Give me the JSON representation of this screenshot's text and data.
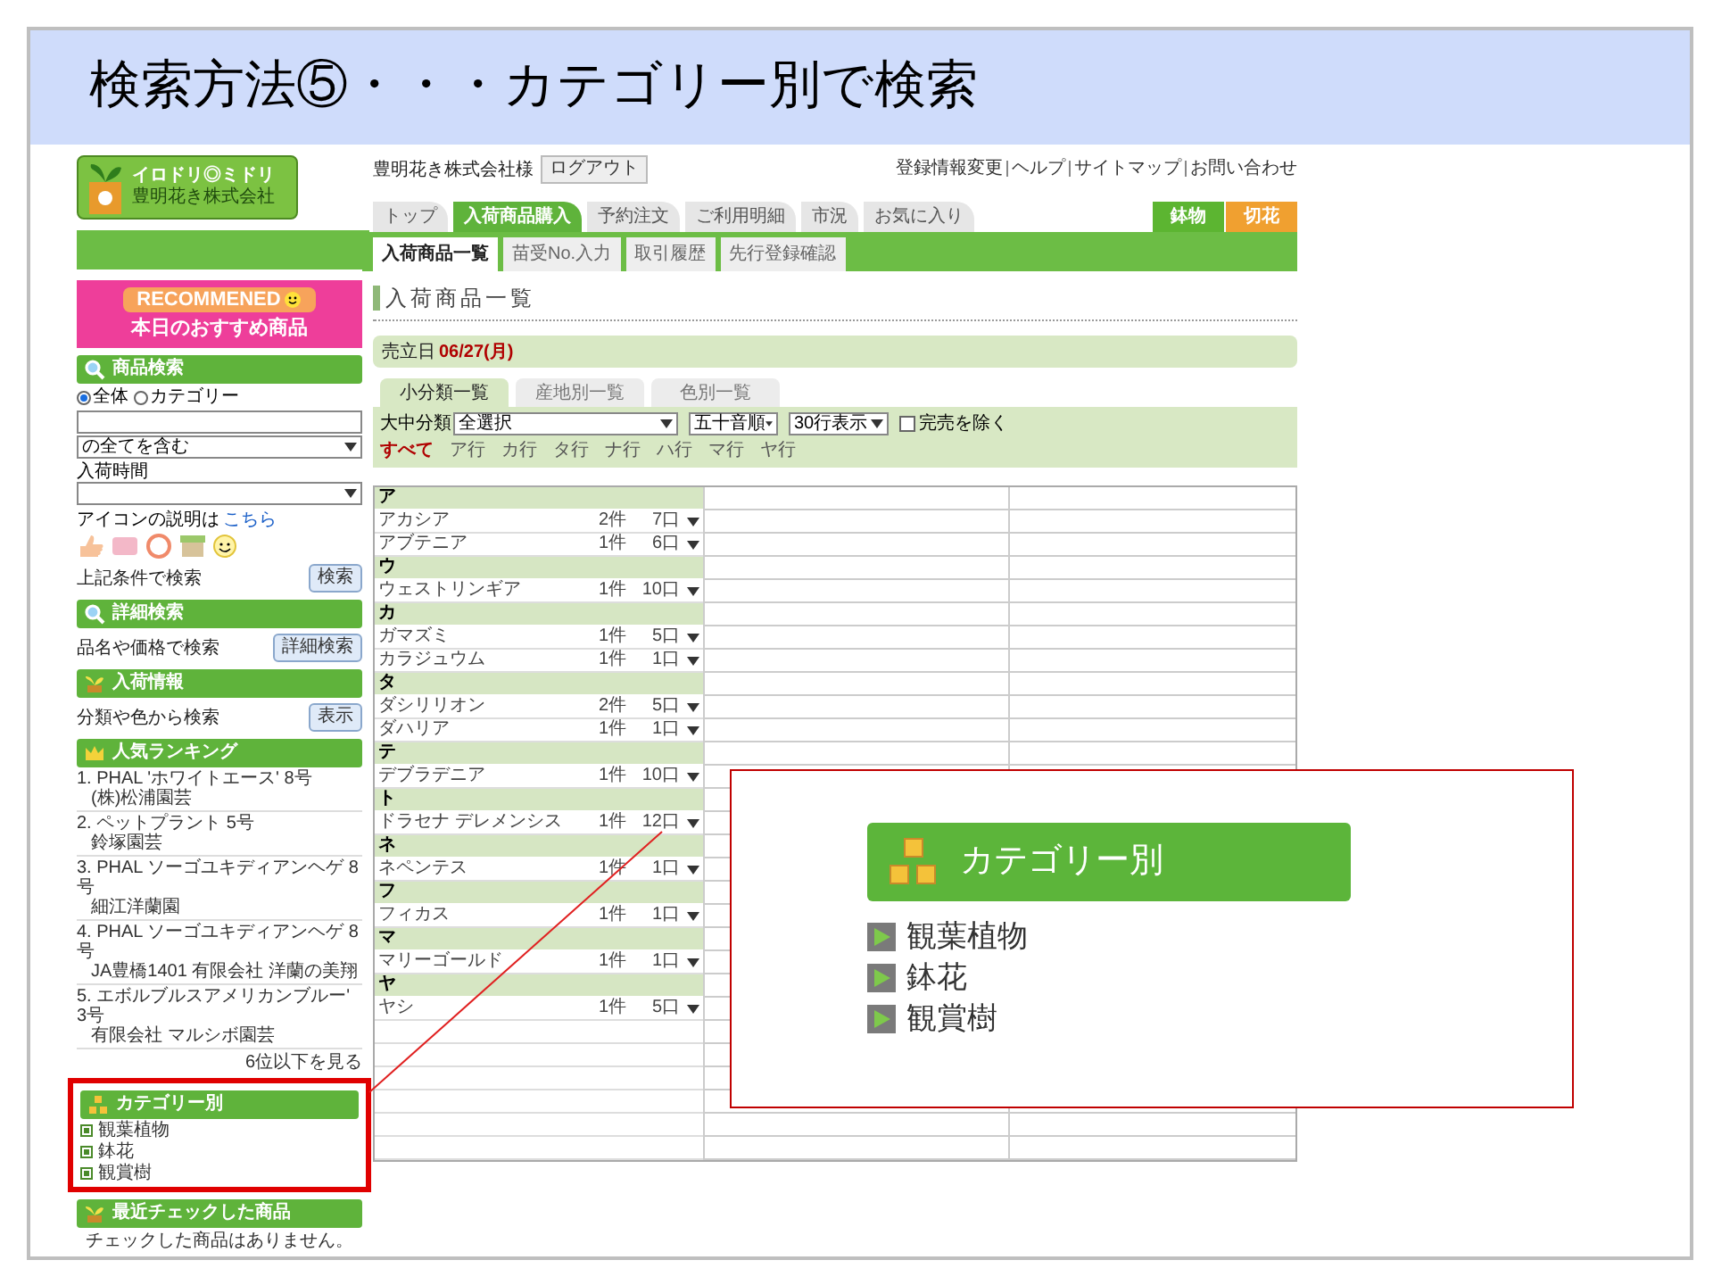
{
  "slide": {
    "title": "検索方法⑤・・・カテゴリー別で検索"
  },
  "logo": {
    "name": "イロドリ◎ミドリ",
    "company": "豊明花き株式会社"
  },
  "header": {
    "customer": "豊明花き株式会社様",
    "logout": "ログアウト",
    "links": [
      "登録情報変更",
      "ヘルプ",
      "サイトマップ",
      "お問い合わせ"
    ]
  },
  "main_tabs": [
    {
      "label": "トップ",
      "selected": false
    },
    {
      "label": "入荷商品購入",
      "selected": true
    },
    {
      "label": "予約注文",
      "selected": false
    },
    {
      "label": "ご利用明細",
      "selected": false
    },
    {
      "label": "市況",
      "selected": false
    },
    {
      "label": "お気に入り",
      "selected": false
    }
  ],
  "market_tabs": [
    {
      "label": "鉢物",
      "color": "#5cb531"
    },
    {
      "label": "切花",
      "color": "#f0a030"
    }
  ],
  "sub_tabs": [
    {
      "label": "入荷商品一覧",
      "selected": true
    },
    {
      "label": "苗受No.入力",
      "selected": false
    },
    {
      "label": "取引履歴",
      "selected": false
    },
    {
      "label": "先行登録確認",
      "selected": false
    }
  ],
  "sidebar": {
    "banner": {
      "title": "RECOMMENED",
      "subtitle": "本日のおすすめ商品"
    },
    "search": {
      "heading": "商品検索",
      "scope": [
        {
          "label": "全体",
          "selected": true
        },
        {
          "label": "カテゴリー",
          "selected": false
        }
      ],
      "match_select": "の全てを含む",
      "time_label": "入荷時間",
      "icon_note": "アイコンの説明は",
      "icon_link": "こちら",
      "hint": "上記条件で検索",
      "button": "検索"
    },
    "detail": {
      "heading": "詳細検索",
      "hint": "品名や価格で検索",
      "button": "詳細検索"
    },
    "arrivals": {
      "heading": "入荷情報",
      "hint": "分類や色から検索",
      "button": "表示"
    },
    "ranking": {
      "heading": "人気ランキング",
      "items": [
        {
          "title": "1. PHAL 'ホワイトエース' 8号",
          "shop": "(株)松浦園芸"
        },
        {
          "title": "2. ペットプラント 5号",
          "shop": "鈴塚園芸"
        },
        {
          "title": "3. PHAL ソーゴユキディアンヘゲ 8号",
          "shop": "細江洋蘭園"
        },
        {
          "title": "4. PHAL ソーゴユキディアンヘゲ 8号",
          "shop": "JA豊橋1401 有限会社 洋蘭の美翔"
        },
        {
          "title": "5. エボルブルスアメリカンブルー' 3号",
          "shop": "有限会社 マルシボ園芸"
        }
      ],
      "more": "6位以下を見る"
    },
    "category": {
      "heading": "カテゴリー別",
      "items": [
        "観葉植物",
        "鉢花",
        "観賞樹"
      ]
    },
    "recent": {
      "heading": "最近チェックした商品",
      "message": "チェックした商品はありません。"
    }
  },
  "page": {
    "heading": "入荷商品一覧",
    "date_label": "売立日",
    "date": "06/27(月)",
    "list_tabs": [
      {
        "label": "小分類一覧",
        "selected": true
      },
      {
        "label": "産地別一覧",
        "selected": false
      },
      {
        "label": "色別一覧",
        "selected": false
      }
    ],
    "filters": {
      "class_label": "大中分類",
      "class_value": "全選択",
      "sort": "五十音順",
      "rows": "30行表示",
      "exclude_soldout": {
        "label": "完売を除く",
        "checked": false
      }
    },
    "kana": [
      {
        "label": "すべて",
        "selected": true
      },
      {
        "label": "ア行",
        "selected": false
      },
      {
        "label": "カ行",
        "selected": false
      },
      {
        "label": "タ行",
        "selected": false
      },
      {
        "label": "ナ行",
        "selected": false
      },
      {
        "label": "ハ行",
        "selected": false
      },
      {
        "label": "マ行",
        "selected": false
      },
      {
        "label": "ヤ行",
        "selected": false
      }
    ]
  },
  "table": {
    "groups": [
      {
        "letter": "ア",
        "items": [
          {
            "name": "アカシア",
            "count": "2件",
            "qty": "7口"
          },
          {
            "name": "アブテニア",
            "count": "1件",
            "qty": "6口"
          }
        ]
      },
      {
        "letter": "ウ",
        "items": [
          {
            "name": "ウェストリンギア",
            "count": "1件",
            "qty": "10口"
          }
        ]
      },
      {
        "letter": "カ",
        "items": [
          {
            "name": "ガマズミ",
            "count": "1件",
            "qty": "5口"
          },
          {
            "name": "カラジュウム",
            "count": "1件",
            "qty": "1口"
          }
        ]
      },
      {
        "letter": "タ",
        "items": [
          {
            "name": "ダシリリオン",
            "count": "2件",
            "qty": "5口"
          },
          {
            "name": "ダハリア",
            "count": "1件",
            "qty": "1口"
          }
        ]
      },
      {
        "letter": "テ",
        "items": [
          {
            "name": "デブラデニア",
            "count": "1件",
            "qty": "10口"
          }
        ]
      },
      {
        "letter": "ト",
        "items": [
          {
            "name": "ドラセナ デレメンシス",
            "count": "1件",
            "qty": "12口"
          }
        ]
      },
      {
        "letter": "ネ",
        "items": [
          {
            "name": "ネペンテス",
            "count": "1件",
            "qty": "1口"
          }
        ]
      },
      {
        "letter": "フ",
        "items": [
          {
            "name": "フィカス",
            "count": "1件",
            "qty": "1口"
          }
        ]
      },
      {
        "letter": "マ",
        "items": [
          {
            "name": "マリーゴールド",
            "count": "1件",
            "qty": "1口"
          }
        ]
      },
      {
        "letter": "ヤ",
        "items": [
          {
            "name": "ヤシ",
            "count": "1件",
            "qty": "5口"
          }
        ]
      }
    ]
  },
  "callout": {
    "heading": "カテゴリー別",
    "items": [
      "観葉植物",
      "鉢花",
      "観賞樹"
    ]
  }
}
